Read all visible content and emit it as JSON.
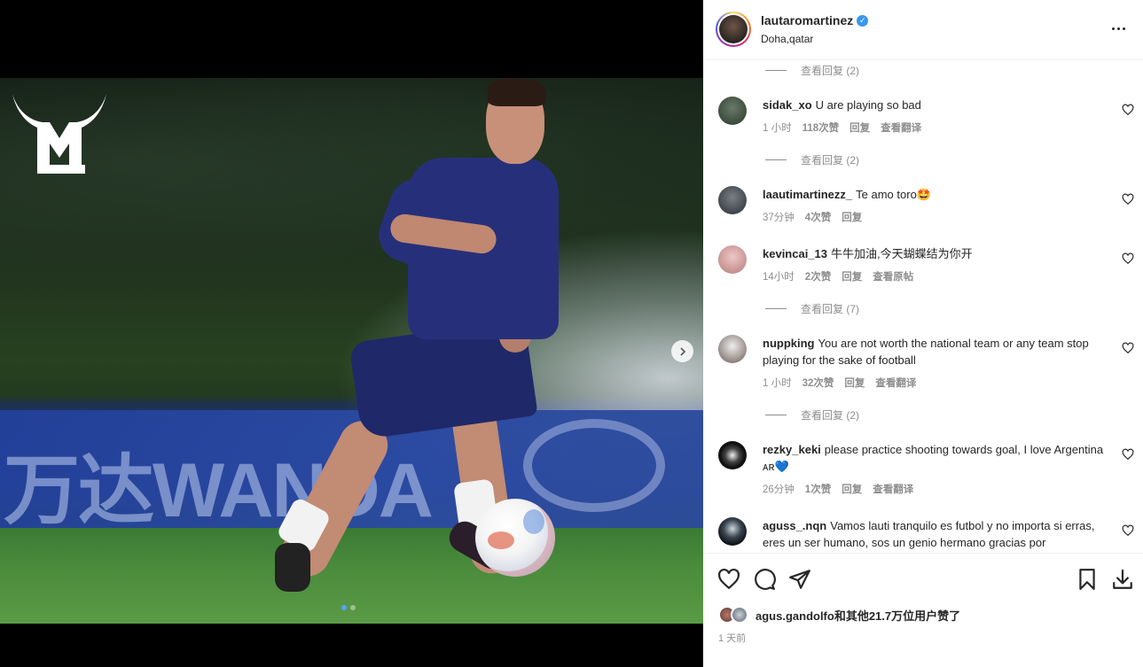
{
  "post": {
    "author": "lautaromartinez",
    "location": "Doha,qatar",
    "time_ago": "1 天前",
    "likes_text": "agus.gandolfo和其他21.7万位用户赞了",
    "carousel": {
      "count": 2,
      "active": 1
    }
  },
  "comments_top_view_replies": "查看回复 (2)",
  "comments": [
    {
      "user": "sidak_xo",
      "text": "U are playing so bad",
      "time": "1 小时",
      "likes": "118次赞",
      "reply": "回复",
      "extra": "查看翻译",
      "view_replies": "查看回复 (2)",
      "avatar_color": "#3a4a3a"
    },
    {
      "user": "laautimartinezz_",
      "text": "Te amo toro🤩",
      "time": "37分钟",
      "likes": "4次赞",
      "reply": "回复",
      "extra": "",
      "view_replies": "",
      "avatar_color": "#4a4e55"
    },
    {
      "user": "kevincai_13",
      "text": "牛牛加油,今天蝴蝶结为你开",
      "time": "14小时",
      "likes": "2次赞",
      "reply": "回复",
      "extra": "查看原帖",
      "view_replies": "查看回复 (7)",
      "avatar_color": "#d9a8a8"
    },
    {
      "user": "nuppking",
      "text": "You are not worth the national team or any team stop playing for the sake of football",
      "time": "1 小时",
      "likes": "32次赞",
      "reply": "回复",
      "extra": "查看翻译",
      "view_replies": "查看回复 (2)",
      "avatar_color": "#7a6a62"
    },
    {
      "user": "rezky_keki",
      "text": "please practice shooting towards goal, I love Argentina ᴀʀ💙",
      "time": "26分钟",
      "likes": "1次赞",
      "reply": "回复",
      "extra": "查看翻译",
      "view_replies": "",
      "avatar_color": "#111111"
    },
    {
      "user": "aguss_.nqn",
      "text": "Vamos lauti tranquilo es futbol y no importa si erras, eres un ser humano, sos un genio hermano gracias por",
      "time": "",
      "likes": "",
      "reply": "",
      "extra": "",
      "view_replies": "",
      "avatar_color": "#1f2a33"
    }
  ],
  "icons": {
    "like": "heart-icon",
    "comment": "comment-icon",
    "share": "send-icon",
    "save": "bookmark-icon",
    "download": "download-icon",
    "more": "more-icon",
    "next": "chevron-right-icon"
  },
  "colors": {
    "verified": "#3897f0",
    "secondary_text": "#8e8e8e",
    "carousel_active": "#5aa0ff"
  }
}
